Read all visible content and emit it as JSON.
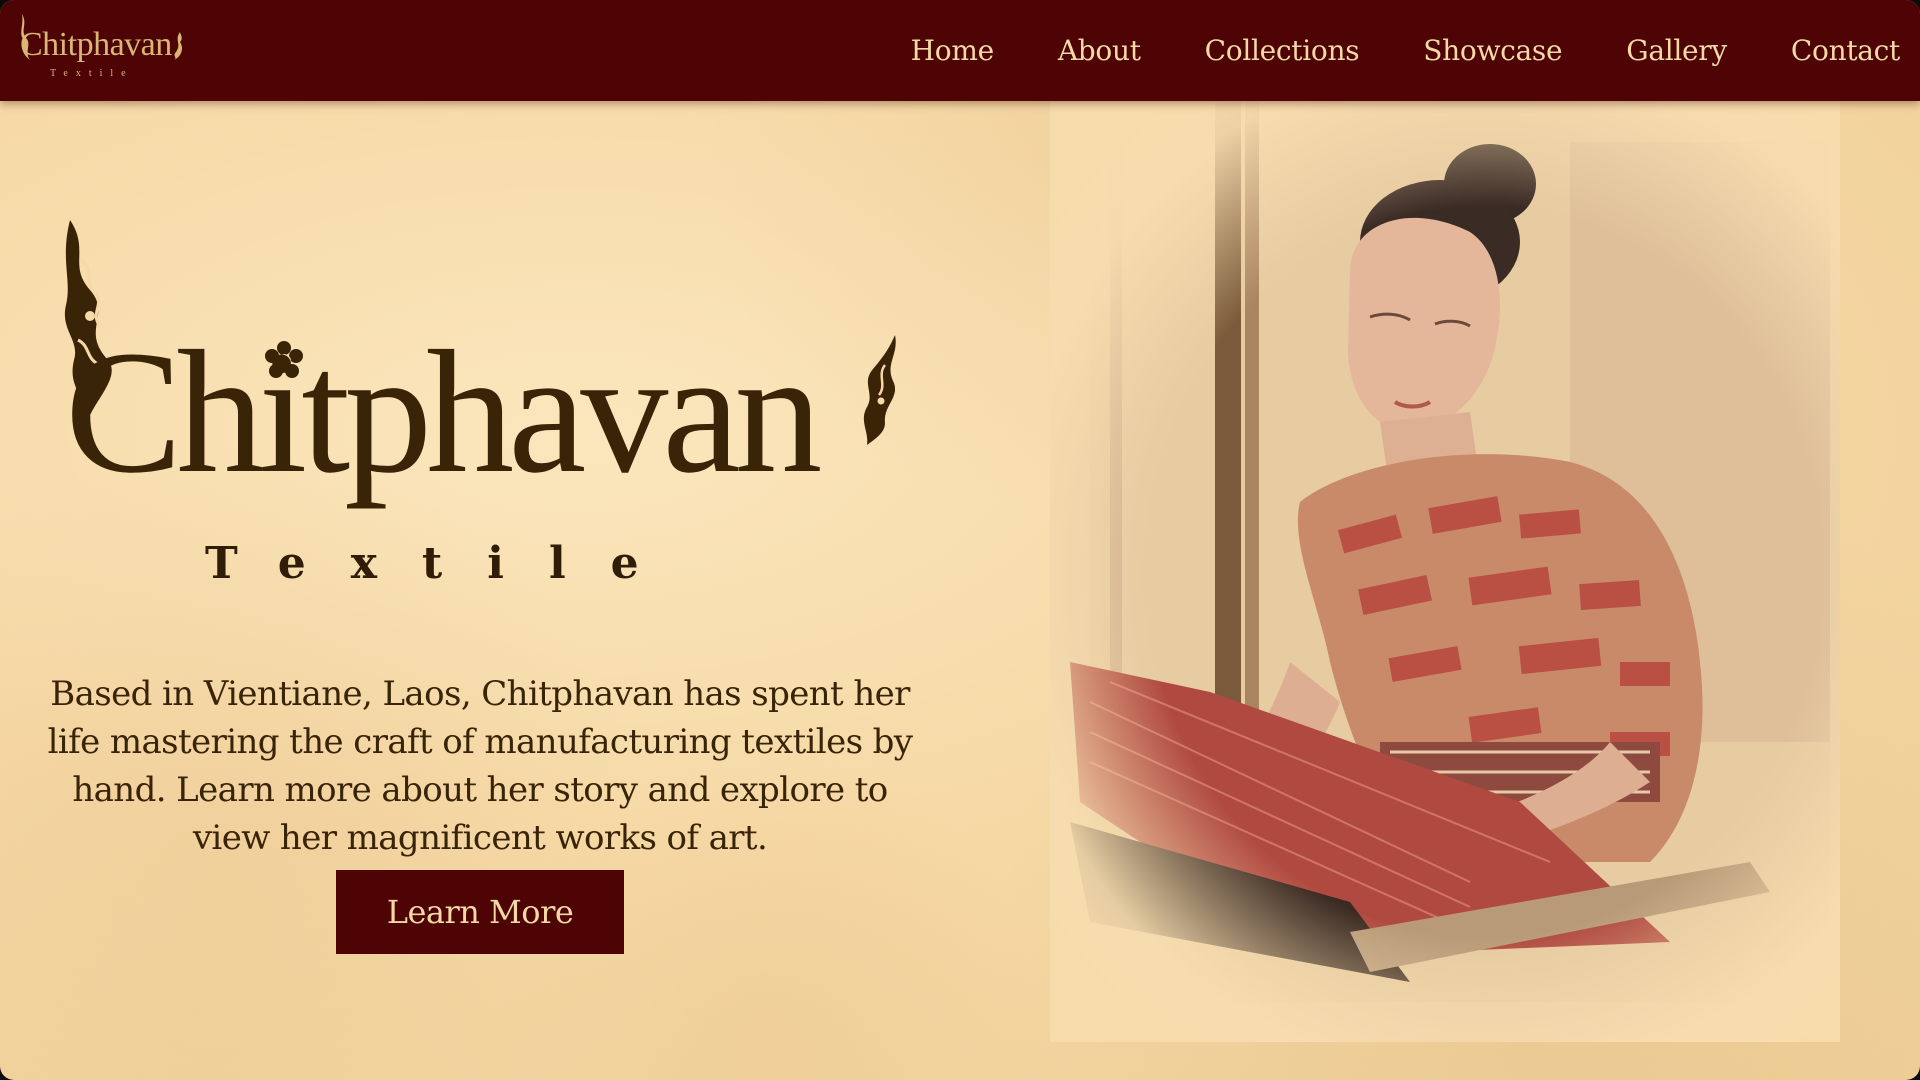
{
  "nav": {
    "logo": {
      "word": "Chitphavan",
      "sub": "Textile"
    },
    "links": [
      "Home",
      "About",
      "Collections",
      "Showcase",
      "Gallery",
      "Contact"
    ]
  },
  "hero": {
    "wordmark": "Chitphavan",
    "subtitle": "Textile",
    "description": "Based in Vientiane, Laos, Chitphavan has spent her life mastering the craft of manufacturing textiles by hand. Learn more about her story and explore to view her magnificent works of art.",
    "cta_label": "Learn More"
  },
  "colors": {
    "maroon": "#4e0305",
    "gold": "#d8b675",
    "cream": "#f6d9a6",
    "dark_brown": "#3a2408"
  },
  "icons": {
    "logo_ornament": "naga-flame-icon",
    "rosette": "rosette-icon"
  }
}
